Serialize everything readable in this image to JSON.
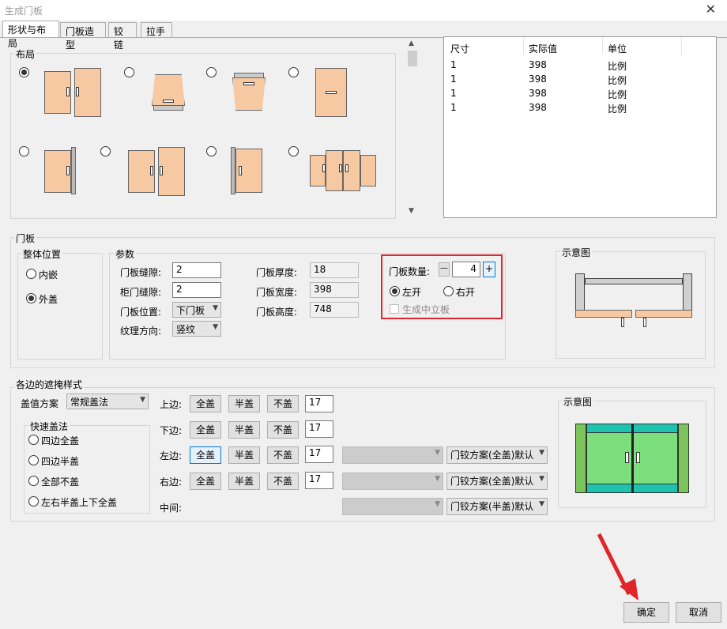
{
  "window": {
    "title": "生成门板",
    "close_icon": "close-icon"
  },
  "tabs": [
    "形状与布局",
    "门板造型",
    "铰链",
    "拉手"
  ],
  "layout": {
    "label": "布局",
    "options_selected_index": 0
  },
  "table": {
    "headers": [
      "尺寸",
      "实际值",
      "单位"
    ],
    "rows": [
      [
        "1",
        "398",
        "比例"
      ],
      [
        "1",
        "398",
        "比例"
      ],
      [
        "1",
        "398",
        "比例"
      ],
      [
        "1",
        "398",
        "比例"
      ]
    ]
  },
  "door_panel": {
    "label": "门板",
    "position": {
      "label": "整体位置",
      "inner": "内嵌",
      "outer": "外盖",
      "selected": "外盖"
    },
    "params": {
      "label": "参数",
      "gap_door_label": "门板缝隙:",
      "gap_door_value": "2",
      "gap_cabinet_label": "柜门缝隙:",
      "gap_cabinet_value": "2",
      "position_label": "门板位置:",
      "position_value": "下门板",
      "grain_label": "纹理方向:",
      "grain_value": "竖纹",
      "thickness_label": "门板厚度:",
      "thickness_value": "18",
      "width_label": "门板宽度:",
      "width_value": "398",
      "height_label": "门板高度:",
      "height_value": "748"
    },
    "count": {
      "label": "门板数量:",
      "value": "4",
      "minus": "—",
      "plus": "+",
      "left": "左开",
      "right": "右开",
      "selected": "左开",
      "middle_board": "生成中立板"
    },
    "diagram_label": "示意图"
  },
  "cover": {
    "label": "各边的遮掩样式",
    "scheme_label": "盖值方案",
    "scheme_value": "常规盖法",
    "quick": {
      "label": "快速盖法",
      "options": [
        "四边全盖",
        "四边半盖",
        "全部不盖",
        "左右半盖上下全盖"
      ]
    },
    "edges": [
      {
        "label": "上边:",
        "value": "17",
        "hinge": null
      },
      {
        "label": "下边:",
        "value": "17",
        "hinge": null
      },
      {
        "label": "左边:",
        "value": "17",
        "hinge": "门铰方案(全盖)默认"
      },
      {
        "label": "右边:",
        "value": "17",
        "hinge": "门铰方案(全盖)默认"
      }
    ],
    "middle": {
      "label": "中间:",
      "hinge": "门铰方案(半盖)默认"
    },
    "btn_full": "全盖",
    "btn_half": "半盖",
    "btn_none": "不盖",
    "diagram_label": "示意图"
  },
  "footer": {
    "ok": "确定",
    "cancel": "取消"
  },
  "colors": {
    "door": "#f7c9a3",
    "highlight": "#e0262a",
    "teal": "#1ec3b0",
    "green": "#7dde7d",
    "side_green": "#7cc45c",
    "accent": "#0078d7"
  }
}
